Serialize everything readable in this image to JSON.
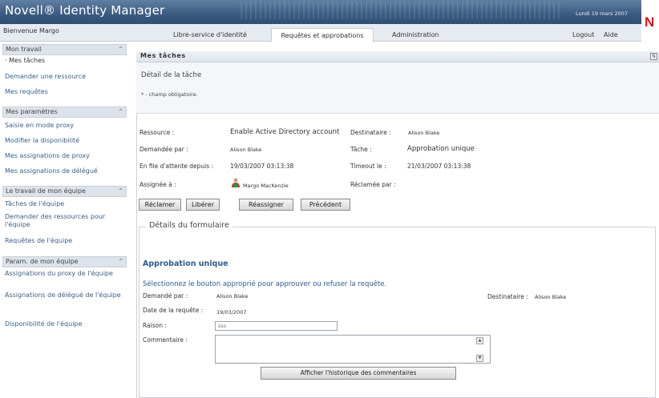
{
  "header": {
    "brand": "Novell® Identity Manager",
    "date": "Lundi 19 mars 2007",
    "logo_letter": "N",
    "welcome": "Bienvenue Margo",
    "tabs": [
      {
        "label": "Libre-service d'identité",
        "active": false
      },
      {
        "label": "Requêtes et approbations",
        "active": true
      },
      {
        "label": "Administration",
        "active": false
      }
    ],
    "logout": "Logout",
    "help": "Aide"
  },
  "sidebar": {
    "sections": [
      {
        "title": "Mon travail",
        "items": [
          "· Mes tâches",
          "Demander une ressource",
          "Mes requêtes"
        ]
      },
      {
        "title": "Mes paramètres",
        "items": [
          "Saisie en mode proxy",
          "Modifier la disponibilité",
          "Mes assignations de proxy",
          "Mes assignations de délégué"
        ]
      },
      {
        "title": "Le travail de mon équipe",
        "items": [
          "Tâches de l'équipe",
          "Demander des ressources pour l'équipe",
          "Requêtes de l'équipe"
        ]
      },
      {
        "title": "Param. de mon équipe",
        "items": [
          "Assignations du proxy de l'équipe",
          "Assignations de délégué de l'équipe",
          "Disponibilité de l'équipe"
        ]
      }
    ]
  },
  "panel": {
    "title": "Mes tâches",
    "detail_title": "Détail de la tâche",
    "required_note": "* - champ obligatoire."
  },
  "task": {
    "resource_label": "Ressource :",
    "resource_value": "Enable Active Directory account",
    "recipient_label": "Destinataire :",
    "recipient_value": "Alison Blake",
    "requested_by_label": "Demandée par :",
    "requested_by_value": "Alison Blake",
    "task_label": "Tâche :",
    "task_value": "Approbation unique",
    "queued_label": "En file d'attente depuis :",
    "queued_value": "19/03/2007 03:13:38",
    "timeout_label": "Timeout le :",
    "timeout_value": "21/03/2007 03:13:38",
    "assigned_label": "Assignée à :",
    "assigned_value": "Margo MacKenzie",
    "claimed_label": "Réclamée par :"
  },
  "actions": {
    "claim": "Réclamer",
    "release": "Libérer",
    "reassign": "Réassigner",
    "previous": "Précédent"
  },
  "form": {
    "legend": "Détails du formulaire",
    "title": "Approbation unique",
    "instruction": "Sélectionnez le bouton approprié pour approuver ou refuser la requête.",
    "requested_by_label": "Demandé par :",
    "requested_by_value": "Alison Blake",
    "recipient_label": "Destinataire :",
    "recipient_value": "Alison Blake",
    "request_date_label": "Date de la requête :",
    "request_date_value": "19/03/2007",
    "reason_label": "Raison :",
    "reason_value": "sss",
    "comment_label": "Commentaire :",
    "comment_value": "",
    "history_button": "Afficher l'historique des commentaires"
  },
  "colors": {
    "brand_bar": "#3d5d83",
    "link": "#3b5e86",
    "form_title": "#2e5b8c",
    "logo": "#d3121c"
  },
  "icons": {
    "panel_toggle": "expand-icon",
    "section_collapse": "double-chevron-up-icon",
    "assignee": "user-icon"
  }
}
